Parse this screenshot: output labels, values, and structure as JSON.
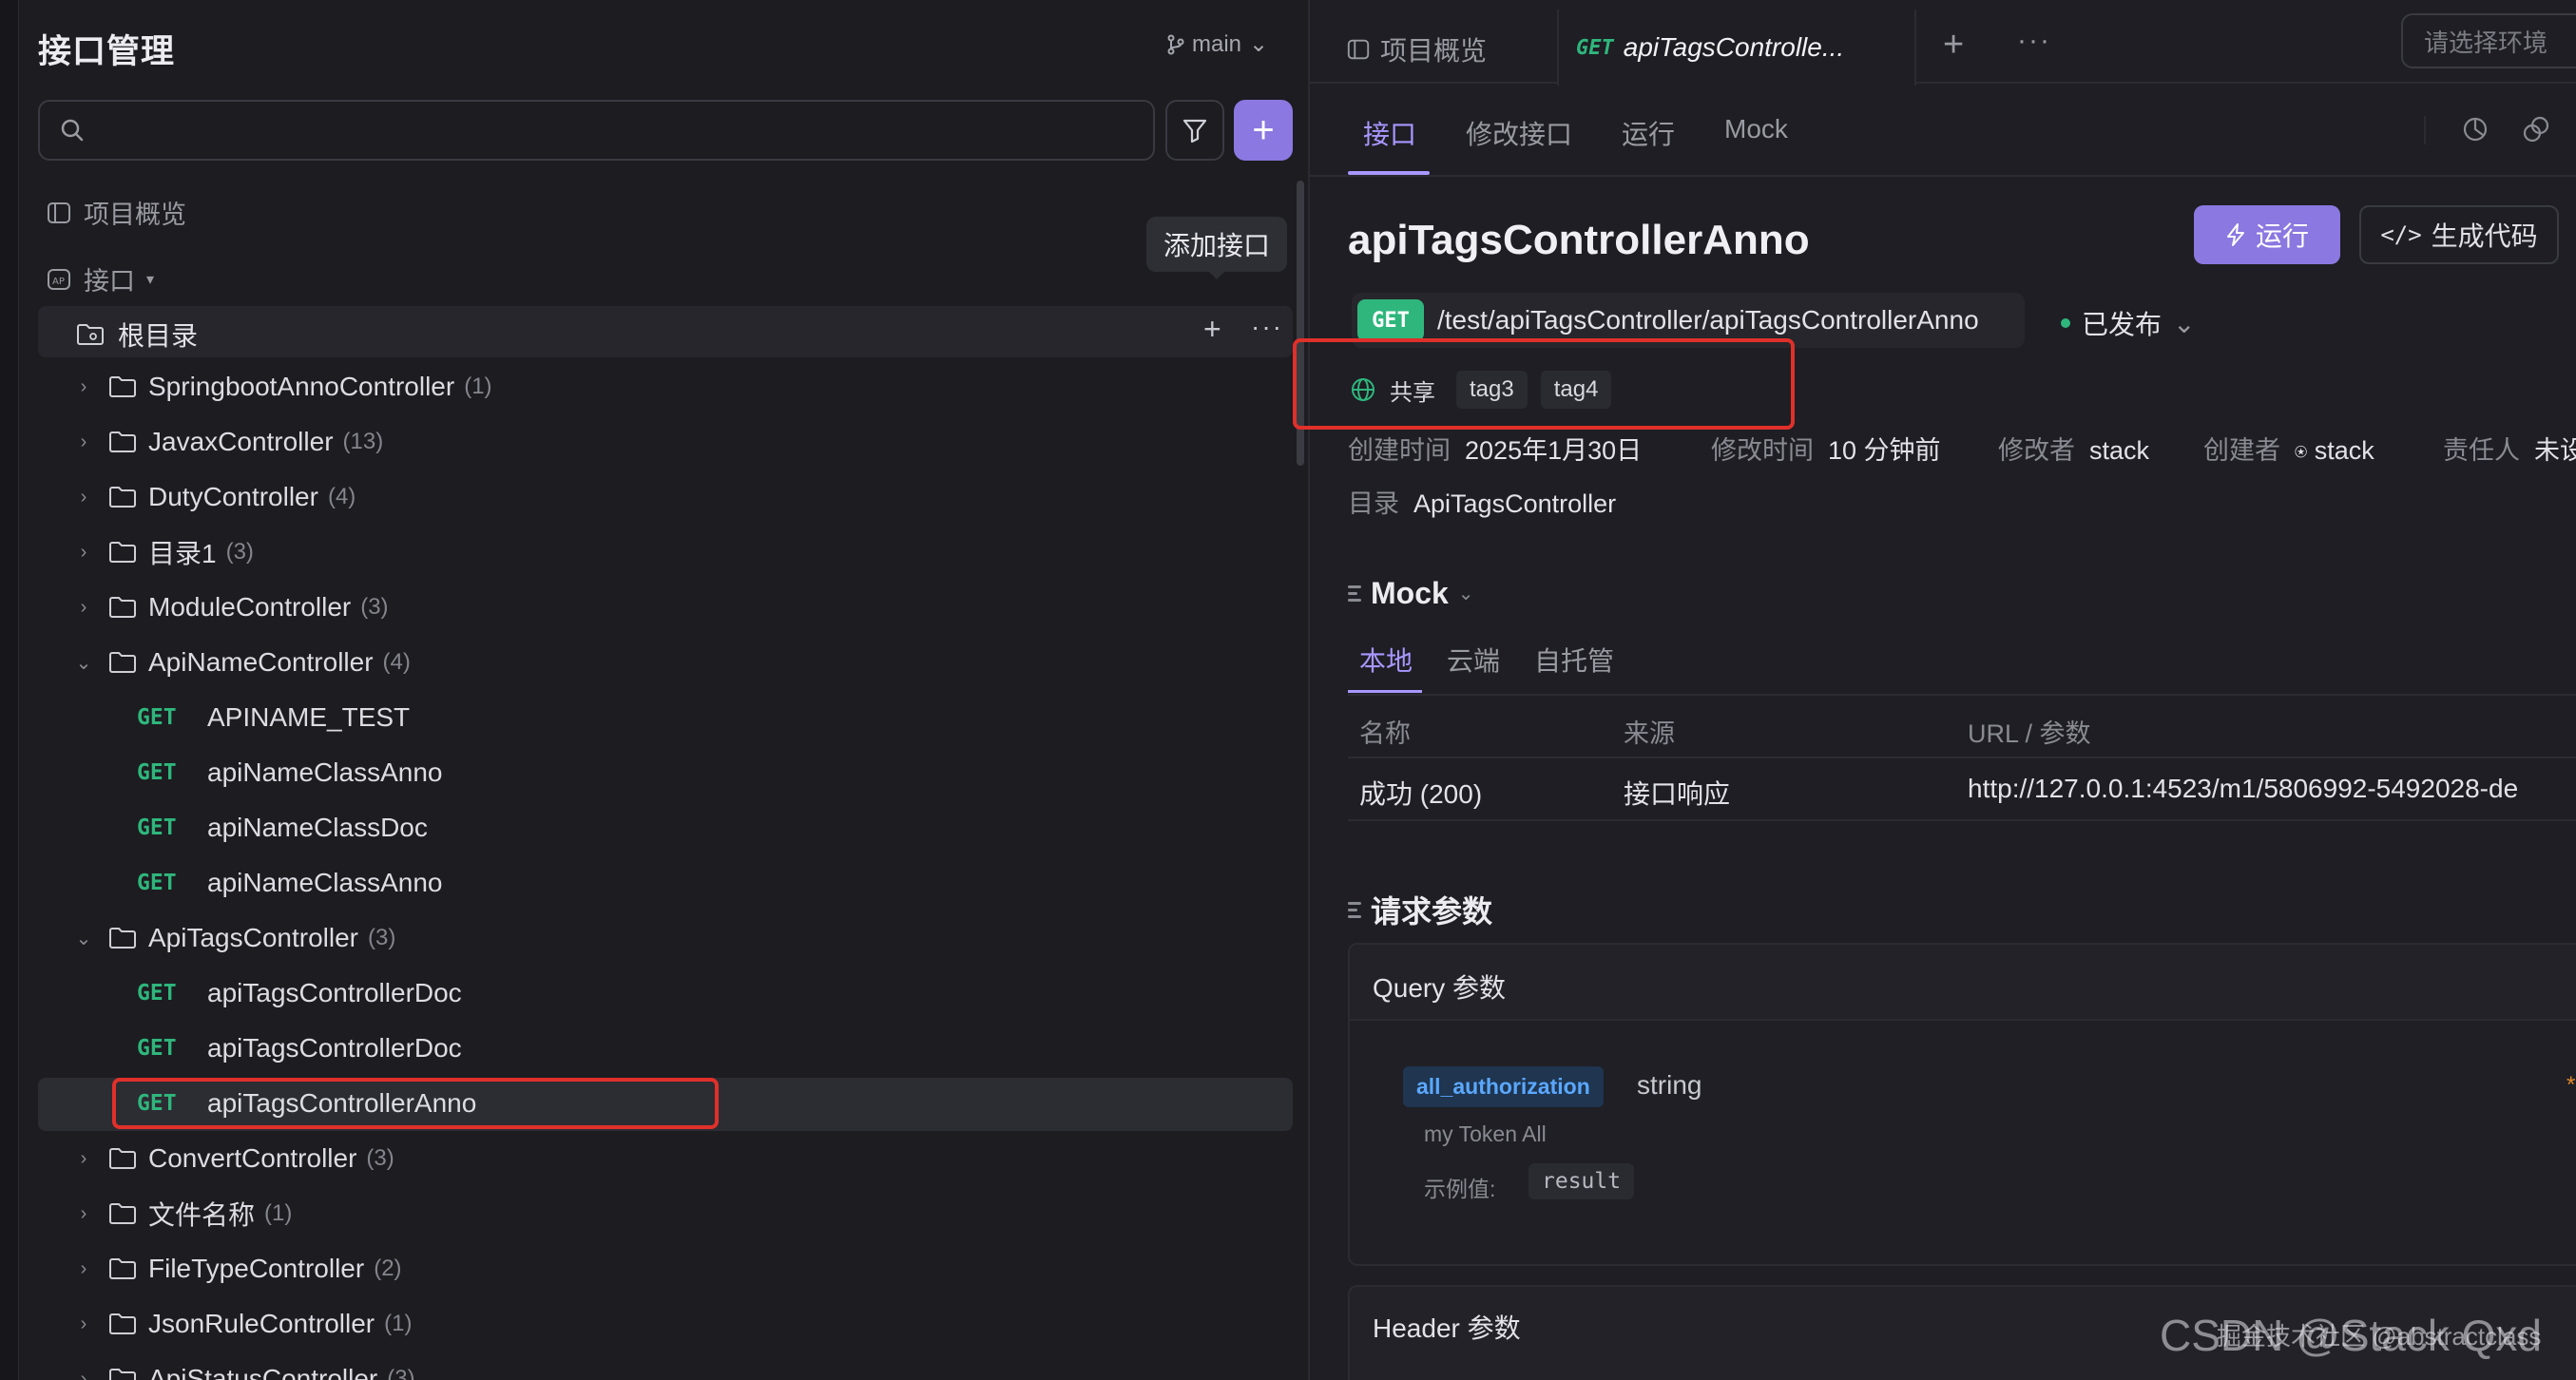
{
  "sidebar": {
    "title": "接口管理",
    "branch": "main",
    "search_placeholder": "",
    "overview_label": "项目概览",
    "api_label": "接口",
    "tooltip": "添加接口",
    "root_label": "根目录",
    "tree": [
      {
        "type": "folder",
        "label": "SpringbootAnnoController",
        "count": "(1)",
        "expanded": false
      },
      {
        "type": "folder",
        "label": "JavaxController",
        "count": "(13)",
        "expanded": false
      },
      {
        "type": "folder",
        "label": "DutyController",
        "count": "(4)",
        "expanded": false
      },
      {
        "type": "folder",
        "label": "目录1",
        "count": "(3)",
        "expanded": false
      },
      {
        "type": "folder",
        "label": "ModuleController",
        "count": "(3)",
        "expanded": false
      },
      {
        "type": "folder",
        "label": "ApiNameController",
        "count": "(4)",
        "expanded": true
      },
      {
        "type": "api",
        "method": "GET",
        "label": "APINAME_TEST"
      },
      {
        "type": "api",
        "method": "GET",
        "label": "apiNameClassAnno"
      },
      {
        "type": "api",
        "method": "GET",
        "label": "apiNameClassDoc"
      },
      {
        "type": "api",
        "method": "GET",
        "label": "apiNameClassAnno"
      },
      {
        "type": "folder",
        "label": "ApiTagsController",
        "count": "(3)",
        "expanded": true
      },
      {
        "type": "api",
        "method": "GET",
        "label": "apiTagsControllerDoc"
      },
      {
        "type": "api",
        "method": "GET",
        "label": "apiTagsControllerDoc"
      },
      {
        "type": "api",
        "method": "GET",
        "label": "apiTagsControllerAnno",
        "selected": true
      },
      {
        "type": "folder",
        "label": "ConvertController",
        "count": "(3)",
        "expanded": false
      },
      {
        "type": "folder",
        "label": "文件名称",
        "count": "(1)",
        "expanded": false
      },
      {
        "type": "folder",
        "label": "FileTypeController",
        "count": "(2)",
        "expanded": false
      },
      {
        "type": "folder",
        "label": "JsonRuleController",
        "count": "(1)",
        "expanded": false
      },
      {
        "type": "folder",
        "label": "ApiStatusController",
        "count": "(3)",
        "expanded": false
      }
    ]
  },
  "topbar": {
    "tab_overview": "项目概览",
    "tab_active_method": "GET",
    "tab_active_label": "apiTagsControlle...",
    "env_placeholder": "请选择环境"
  },
  "subtabs": [
    "接口",
    "修改接口",
    "运行",
    "Mock"
  ],
  "api": {
    "title": "apiTagsControllerAnno",
    "run_label": "运行",
    "gencode_label": "生成代码",
    "method": "GET",
    "path": "/test/apiTagsController/apiTagsControllerAnno",
    "status": "已发布",
    "share_label": "共享",
    "tags": [
      "tag3",
      "tag4"
    ],
    "meta": {
      "created_key": "创建时间",
      "created_val": "2025年1月30日",
      "modified_key": "修改时间",
      "modified_val": "10 分钟前",
      "modifier_key": "修改者",
      "modifier_val": "stack",
      "creator_key": "创建者",
      "creator_val": "stack",
      "owner_key": "责任人",
      "owner_val": "未设"
    },
    "dir_key": "目录",
    "dir_val": "ApiTagsController"
  },
  "mock": {
    "title": "Mock",
    "tabs": [
      "本地",
      "云端",
      "自托管"
    ],
    "columns": [
      "名称",
      "来源",
      "URL / 参数"
    ],
    "rows": [
      {
        "name": "成功 (200)",
        "source": "接口响应",
        "url": "http://127.0.0.1:4523/m1/5806992-5492028-de"
      }
    ]
  },
  "request": {
    "title": "请求参数",
    "query_title": "Query 参数",
    "param_name": "all_authorization",
    "param_type": "string",
    "param_desc": "my Token All",
    "example_key": "示例值:",
    "example_val": "result",
    "header_title": "Header 参数"
  },
  "watermark": "CSDN @Stack Qxd",
  "watermark_small": "掘金技术社区 @abstractclass",
  "colors": {
    "accent": "#8b78e0",
    "get": "#2fb67c",
    "highlight": "#e0302a"
  }
}
